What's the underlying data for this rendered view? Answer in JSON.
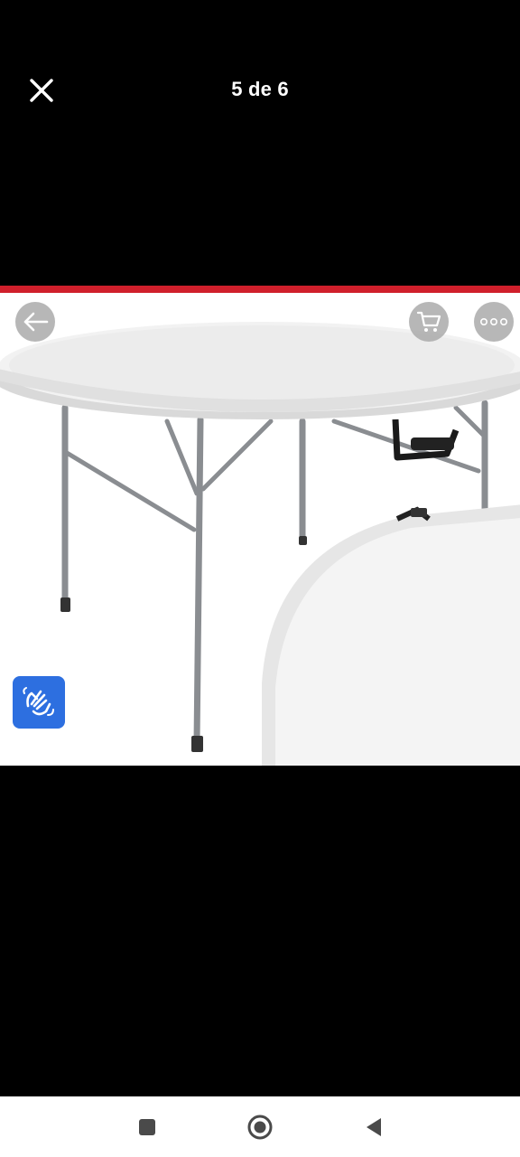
{
  "header": {
    "counter_text": "5 de 6",
    "close_icon": "close-icon"
  },
  "photo": {
    "accent_color": "#d01f2b",
    "subject": "round-folding-table",
    "controls": {
      "back_icon": "arrow-left-icon",
      "cart_icon": "cart-icon",
      "more_icon": "more-dots-icon",
      "accessibility_icon": "sign-language-icon",
      "accessibility_color": "#2d6fe0"
    }
  },
  "navigation_bar": {
    "buttons": [
      "recent-apps-icon",
      "home-icon",
      "back-icon"
    ]
  }
}
